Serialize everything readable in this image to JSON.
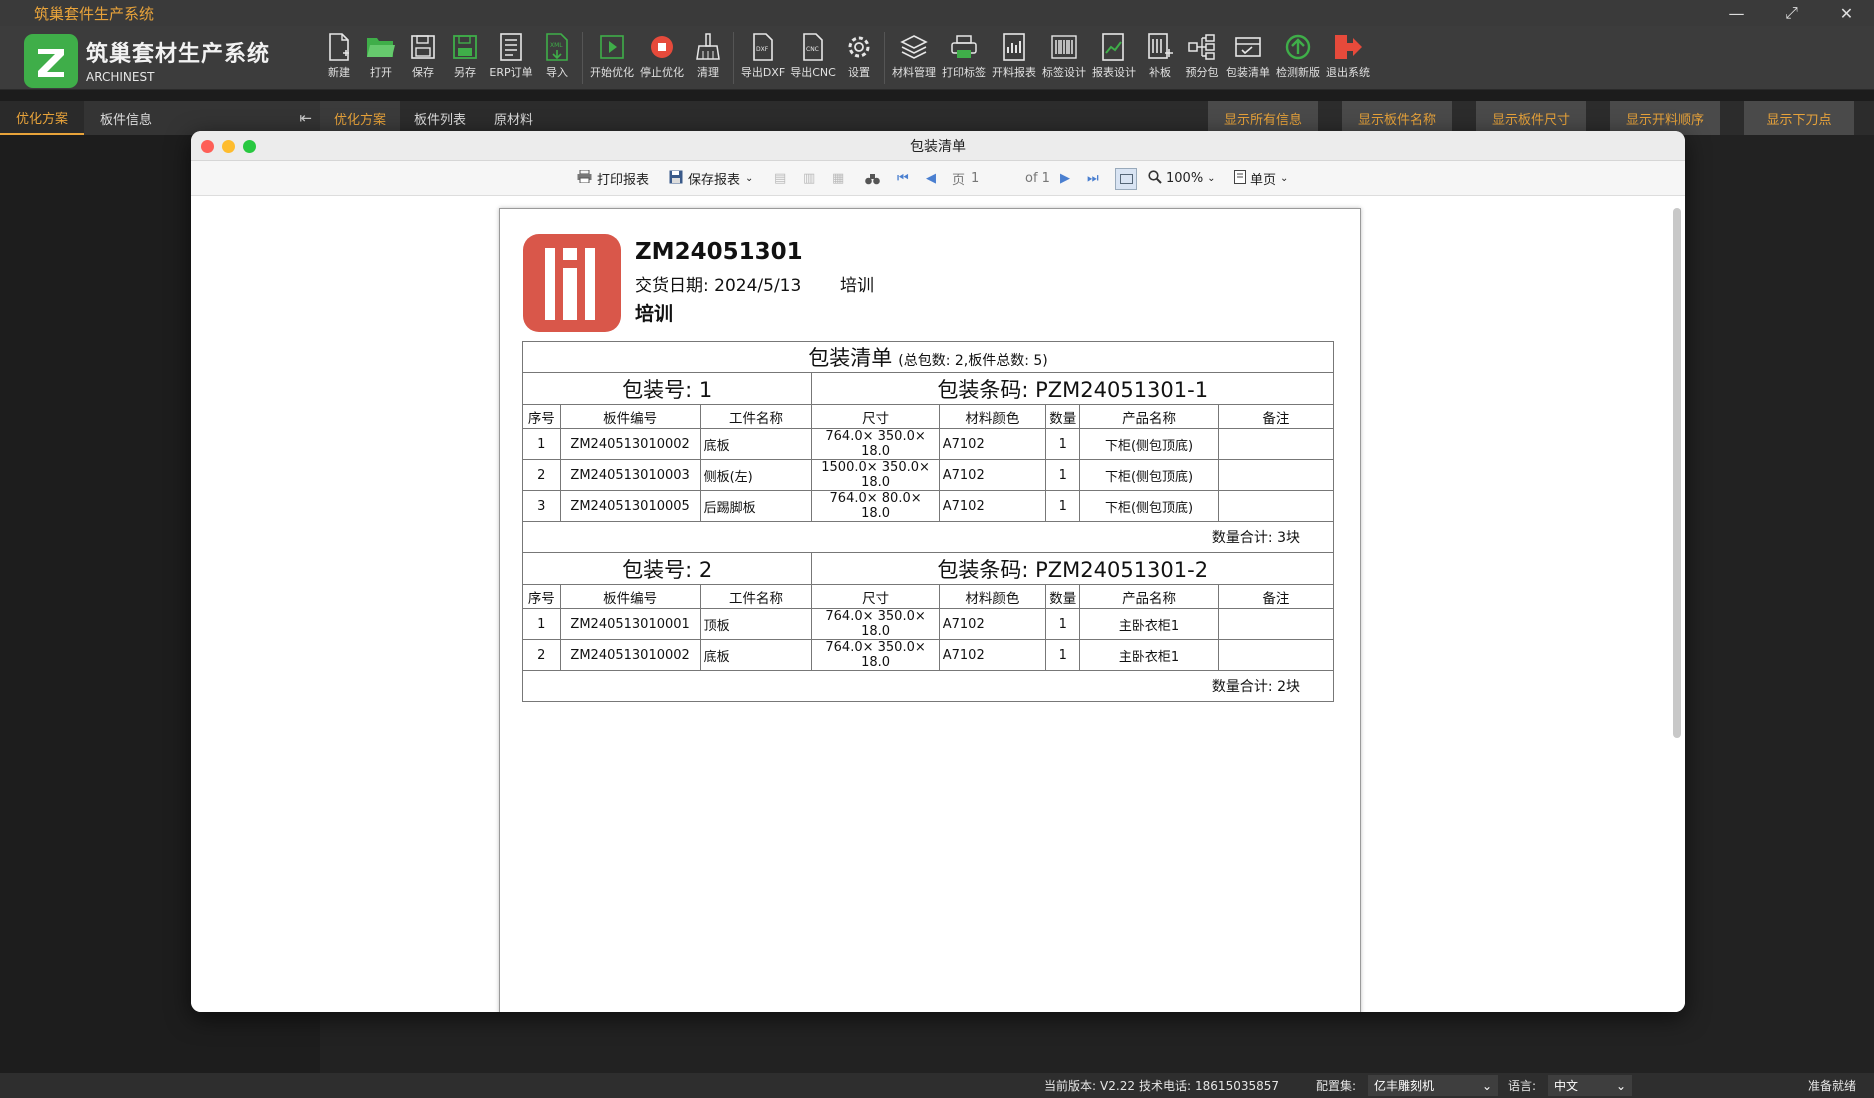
{
  "window": {
    "title": "筑巢套件生产系统"
  },
  "brand": {
    "name": "筑巢套材生产系统",
    "sub": "ARCHINEST"
  },
  "toolbar": [
    {
      "label": "新建",
      "icon": "new-file-icon"
    },
    {
      "label": "打开",
      "icon": "folder-open-icon"
    },
    {
      "label": "保存",
      "icon": "save-icon"
    },
    {
      "label": "另存",
      "icon": "save-as-icon"
    },
    {
      "label": "ERP订单",
      "icon": "erp-order-icon"
    },
    {
      "label": "导入",
      "icon": "xml-import-icon"
    },
    {
      "label": "开始优化",
      "icon": "play-icon"
    },
    {
      "label": "停止优化",
      "icon": "stop-icon"
    },
    {
      "label": "清理",
      "icon": "broom-icon"
    },
    {
      "label": "导出DXF",
      "icon": "dxf-file-icon"
    },
    {
      "label": "导出CNC",
      "icon": "cnc-file-icon"
    },
    {
      "label": "设置",
      "icon": "gear-icon"
    },
    {
      "label": "材料管理",
      "icon": "layers-icon"
    },
    {
      "label": "打印标签",
      "icon": "print-label-icon"
    },
    {
      "label": "开料报表",
      "icon": "cut-report-icon"
    },
    {
      "label": "标签设计",
      "icon": "barcode-icon"
    },
    {
      "label": "报表设计",
      "icon": "report-design-icon"
    },
    {
      "label": "补板",
      "icon": "patch-board-icon"
    },
    {
      "label": "预分包",
      "icon": "tree-icon"
    },
    {
      "label": "包装清单",
      "icon": "package-list-icon"
    },
    {
      "label": "检测新版",
      "icon": "update-icon"
    },
    {
      "label": "退出系统",
      "icon": "exit-icon"
    }
  ],
  "left_tabs": [
    "优化方案",
    "板件信息"
  ],
  "main_tabs": [
    "优化方案",
    "板件列表",
    "原材料"
  ],
  "show_buttons": [
    "显示所有信息",
    "显示板件名称",
    "显示板件尺寸",
    "显示开料顺序",
    "显示下刀点"
  ],
  "status": {
    "version_label": "当前版本:",
    "version": "V2.22",
    "phone_label": "技术电话:",
    "phone": "18615035857",
    "config_label": "配置集:",
    "config": "亿丰雕刻机",
    "lang_label": "语言:",
    "lang": "中文",
    "ready": "准备就绪"
  },
  "dialog": {
    "title": "包装清单",
    "print": "打印报表",
    "save": "保存报表",
    "page_label": "页",
    "page": "1",
    "of": "of 1",
    "zoom": "100%",
    "view": "单页"
  },
  "report": {
    "order_no": "ZM24051301",
    "date_label": "交货日期:",
    "date": "2024/5/13",
    "customer": "培训",
    "customer2": "培训",
    "title": "包装清单",
    "summary": "(总包数: 2,板件总数: 5)",
    "headers": [
      "序号",
      "板件编号",
      "工件名称",
      "尺寸",
      "材料颜色",
      "数量",
      "产品名称",
      "备注"
    ],
    "packages": [
      {
        "no_label": "包装号: 1",
        "code_label": "包装条码: PZM24051301-1",
        "rows": [
          [
            "1",
            "ZM240513010002",
            "底板",
            "764.0× 350.0× 18.0",
            "A7102",
            "1",
            "下柜(侧包顶底)",
            ""
          ],
          [
            "2",
            "ZM240513010003",
            "侧板(左)",
            "1500.0× 350.0× 18.0",
            "A7102",
            "1",
            "下柜(侧包顶底)",
            ""
          ],
          [
            "3",
            "ZM240513010005",
            "后踢脚板",
            "764.0× 80.0× 18.0",
            "A7102",
            "1",
            "下柜(侧包顶底)",
            ""
          ]
        ],
        "total": "数量合计: 3块"
      },
      {
        "no_label": "包装号: 2",
        "code_label": "包装条码: PZM24051301-2",
        "rows": [
          [
            "1",
            "ZM240513010001",
            "顶板",
            "764.0× 350.0× 18.0",
            "A7102",
            "1",
            "主卧衣柜1",
            ""
          ],
          [
            "2",
            "ZM240513010002",
            "底板",
            "764.0× 350.0× 18.0",
            "A7102",
            "1",
            "主卧衣柜1",
            ""
          ]
        ],
        "total": "数量合计: 2块"
      }
    ]
  },
  "colors": {
    "accent": "#e8a33a",
    "logo_green": "#3fae49",
    "report_red": "#d9574a"
  }
}
